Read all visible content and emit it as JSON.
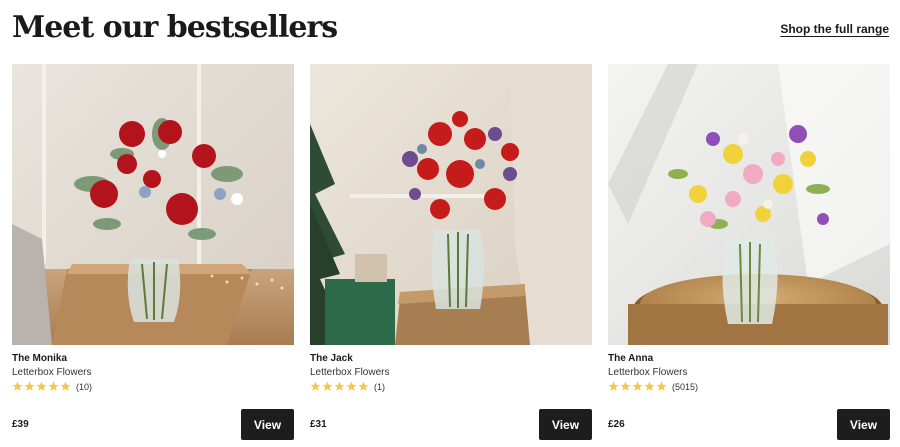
{
  "header": {
    "title": "Meet our bestsellers",
    "link_label": "Shop the full range"
  },
  "products": [
    {
      "name": "The Monika",
      "brand": "Letterbox Flowers",
      "rating": 5,
      "reviews": "(10)",
      "price": "£39",
      "button": "View"
    },
    {
      "name": "The Jack",
      "brand": "Letterbox Flowers",
      "rating": 5,
      "reviews": "(1)",
      "price": "£31",
      "button": "View"
    },
    {
      "name": "The Anna",
      "brand": "Letterbox Flowers",
      "rating": 5,
      "reviews": "(5015)",
      "price": "£26",
      "button": "View"
    }
  ],
  "colors": {
    "star": "#f2c94c",
    "button_bg": "#1d1d1d",
    "button_text": "#ffffff"
  }
}
